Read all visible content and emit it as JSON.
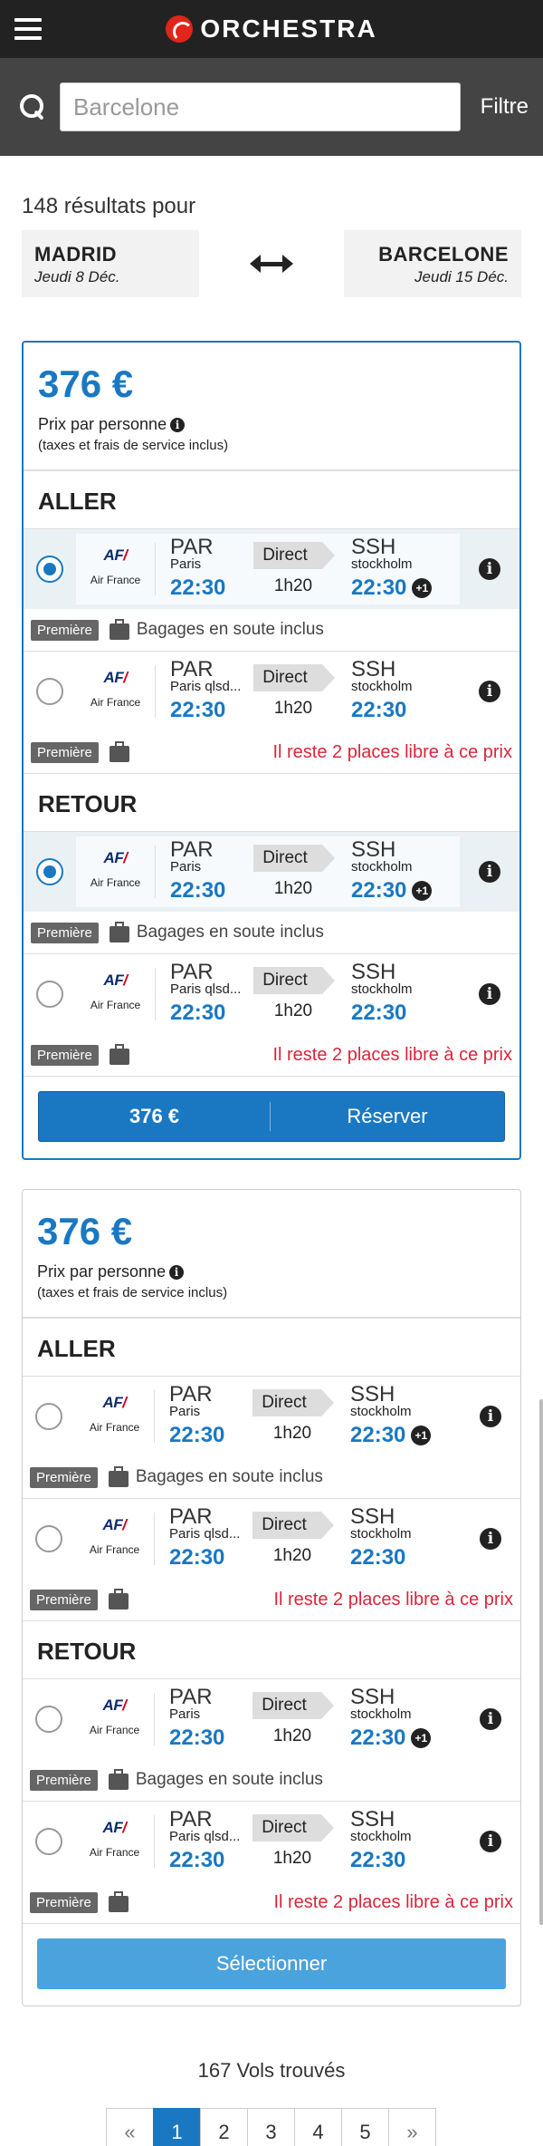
{
  "app": {
    "name": "ORCHESTRA"
  },
  "search": {
    "value": "",
    "placeholder": "Barcelone",
    "filter_label": "Filtre"
  },
  "results": {
    "count_label": "148 résultats pour"
  },
  "route": {
    "from": {
      "city": "MADRID",
      "date": "Jeudi 8 Déc."
    },
    "to": {
      "city": "BARCELONE",
      "date": "Jeudi 15 Déc."
    }
  },
  "cards": [
    {
      "price": "376 €",
      "price_label": "Prix par personne",
      "price_note": "(taxes et frais de service inclus)",
      "outbound_title": "ALLER",
      "return_title": "RETOUR",
      "outbound": [
        {
          "selected": true,
          "airline": "Air France",
          "dep_code": "PAR",
          "dep_city": "Paris",
          "dep_time": "22:30",
          "type": "Direct",
          "duration": "1h20",
          "arr_code": "SSH",
          "arr_city": "stockholm",
          "arr_time": "22:30",
          "plus": "+1",
          "class": "Première",
          "note": "Bagages en soute inclus",
          "warning": ""
        },
        {
          "selected": false,
          "airline": "Air France",
          "dep_code": "PAR",
          "dep_city": "Paris qlsd...",
          "dep_time": "22:30",
          "type": "Direct",
          "duration": "1h20",
          "arr_code": "SSH",
          "arr_city": "stockholm",
          "arr_time": "22:30",
          "plus": "",
          "class": "Première",
          "note": "",
          "warning": "Il reste 2 places libre à ce prix"
        }
      ],
      "return": [
        {
          "selected": true,
          "airline": "Air France",
          "dep_code": "PAR",
          "dep_city": "Paris",
          "dep_time": "22:30",
          "type": "Direct",
          "duration": "1h20",
          "arr_code": "SSH",
          "arr_city": "stockholm",
          "arr_time": "22:30",
          "plus": "+1",
          "class": "Première",
          "note": "Bagages en soute inclus",
          "warning": ""
        },
        {
          "selected": false,
          "airline": "Air France",
          "dep_code": "PAR",
          "dep_city": "Paris qlsd...",
          "dep_time": "22:30",
          "type": "Direct",
          "duration": "1h20",
          "arr_code": "SSH",
          "arr_city": "stockholm",
          "arr_time": "22:30",
          "plus": "",
          "class": "Première",
          "note": "",
          "warning": "Il reste 2 places libre à ce prix"
        }
      ],
      "action": {
        "price": "376 €",
        "label": "Réserver"
      }
    },
    {
      "price": "376 €",
      "price_label": "Prix par personne",
      "price_note": "(taxes et frais de service inclus)",
      "outbound_title": "ALLER",
      "return_title": "RETOUR",
      "outbound": [
        {
          "selected": false,
          "airline": "Air France",
          "dep_code": "PAR",
          "dep_city": "Paris",
          "dep_time": "22:30",
          "type": "Direct",
          "duration": "1h20",
          "arr_code": "SSH",
          "arr_city": "stockholm",
          "arr_time": "22:30",
          "plus": "+1",
          "class": "Première",
          "note": "Bagages en soute inclus",
          "warning": ""
        },
        {
          "selected": false,
          "airline": "Air France",
          "dep_code": "PAR",
          "dep_city": "Paris qlsd...",
          "dep_time": "22:30",
          "type": "Direct",
          "duration": "1h20",
          "arr_code": "SSH",
          "arr_city": "stockholm",
          "arr_time": "22:30",
          "plus": "",
          "class": "Première",
          "note": "",
          "warning": "Il reste 2 places libre à ce prix"
        }
      ],
      "return": [
        {
          "selected": false,
          "airline": "Air France",
          "dep_code": "PAR",
          "dep_city": "Paris",
          "dep_time": "22:30",
          "type": "Direct",
          "duration": "1h20",
          "arr_code": "SSH",
          "arr_city": "stockholm",
          "arr_time": "22:30",
          "plus": "+1",
          "class": "Première",
          "note": "Bagages en soute inclus",
          "warning": ""
        },
        {
          "selected": false,
          "airline": "Air France",
          "dep_code": "PAR",
          "dep_city": "Paris qlsd...",
          "dep_time": "22:30",
          "type": "Direct",
          "duration": "1h20",
          "arr_code": "SSH",
          "arr_city": "stockholm",
          "arr_time": "22:30",
          "plus": "",
          "class": "Première",
          "note": "",
          "warning": "Il reste 2 places libre à ce prix"
        }
      ],
      "action": {
        "label": "Sélectionner"
      }
    }
  ],
  "footer": {
    "found_label": "167 Vols trouvés"
  },
  "pagination": {
    "prev": "«",
    "pages": [
      "1",
      "2",
      "3",
      "4",
      "5"
    ],
    "current": "1",
    "next": "»"
  },
  "colors": {
    "accent": "#1a78c2",
    "warning": "#d9263a",
    "topbar": "#222222",
    "searchbar": "#444444",
    "brand": "#e1251b"
  }
}
